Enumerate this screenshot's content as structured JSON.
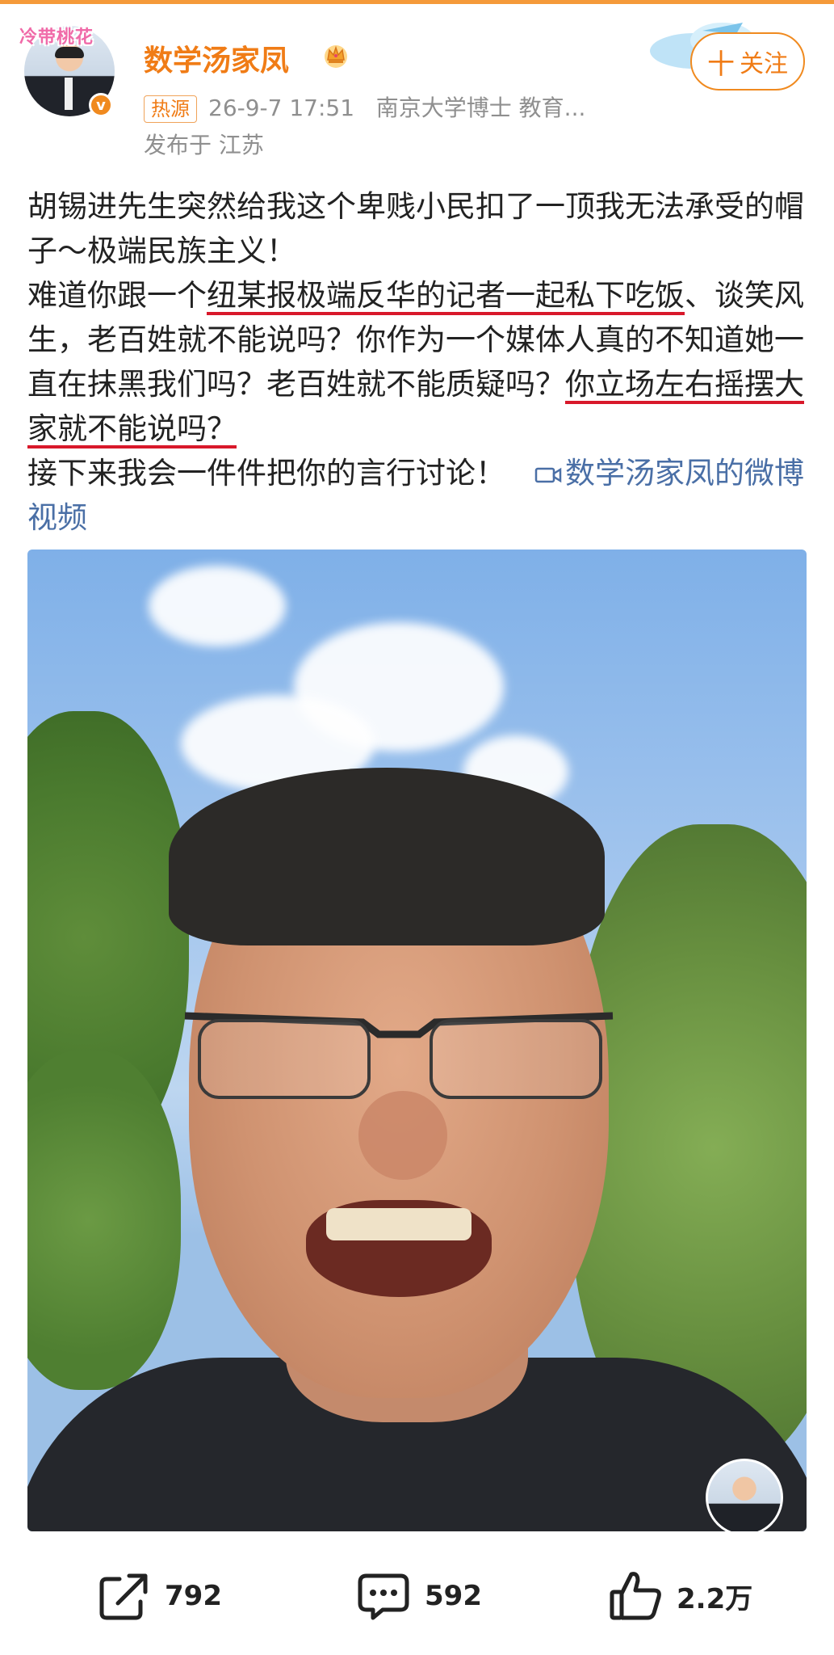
{
  "header": {
    "username": "数学汤家凤",
    "hot_tag": "热源",
    "timestamp": "26-9-7 17:51",
    "bio": "南京大学博士 教育...",
    "location": "发布于 江苏",
    "follow_label": "关注",
    "follow_plus": "十",
    "avatar_frame_text": "冷带桃花",
    "verified_badge": "v"
  },
  "post": {
    "line1": "胡锡进先生突然给我这个卑贱小民扣了一顶我无法承受的帽子～极端民族主义！",
    "line2_pre": "难道你跟一个",
    "line2_underlined": "纽某报极端反华的记者一起私下吃饭",
    "line2_post": "、谈笑风生，老百姓就不能说吗？你作为一个媒体人真的不知道她一直在抹黑我们吗？老百姓就不能质疑吗？",
    "line3_underlined": "你立场左右摇摆大家就不能说吗？",
    "line4": "接下来我会一件件把你的言行讨论！",
    "video_link": "数学汤家凤的微博视频"
  },
  "actions": {
    "share_count": "792",
    "comment_count": "592",
    "like_count": "2.2万"
  },
  "icons": {
    "crown": "crown-icon",
    "video": "video-camera-icon",
    "share": "share-icon",
    "comment": "comment-icon",
    "like": "thumbs-up-icon"
  },
  "colors": {
    "username": "#f07c16",
    "link": "#4a6fa6",
    "underline": "#d8182a",
    "top_accent": "#f59a3a"
  }
}
